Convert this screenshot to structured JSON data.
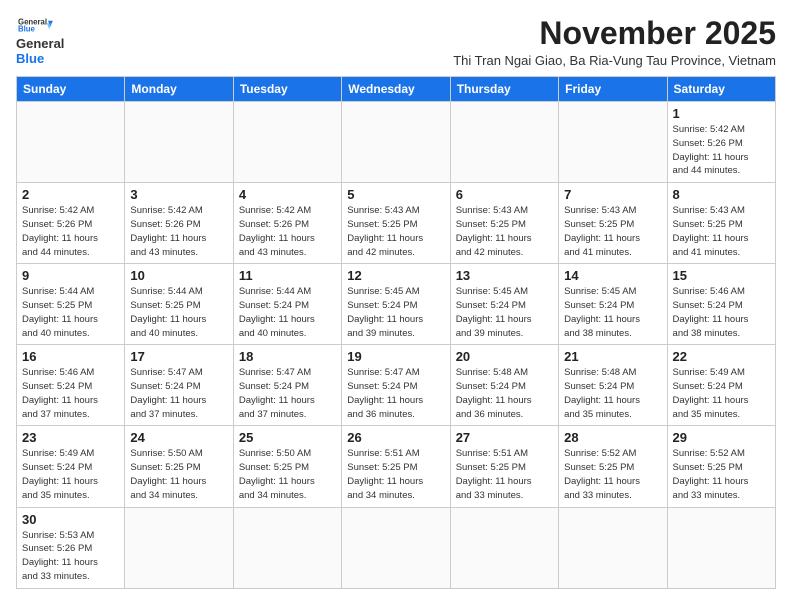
{
  "header": {
    "logo_line1": "General",
    "logo_line2": "Blue",
    "month_title": "November 2025",
    "location": "Thi Tran Ngai Giao, Ba Ria-Vung Tau Province, Vietnam"
  },
  "weekdays": [
    "Sunday",
    "Monday",
    "Tuesday",
    "Wednesday",
    "Thursday",
    "Friday",
    "Saturday"
  ],
  "weeks": [
    [
      {
        "day": "",
        "info": ""
      },
      {
        "day": "",
        "info": ""
      },
      {
        "day": "",
        "info": ""
      },
      {
        "day": "",
        "info": ""
      },
      {
        "day": "",
        "info": ""
      },
      {
        "day": "",
        "info": ""
      },
      {
        "day": "1",
        "info": "Sunrise: 5:42 AM\nSunset: 5:26 PM\nDaylight: 11 hours\nand 44 minutes."
      }
    ],
    [
      {
        "day": "2",
        "info": "Sunrise: 5:42 AM\nSunset: 5:26 PM\nDaylight: 11 hours\nand 44 minutes."
      },
      {
        "day": "3",
        "info": "Sunrise: 5:42 AM\nSunset: 5:26 PM\nDaylight: 11 hours\nand 43 minutes."
      },
      {
        "day": "4",
        "info": "Sunrise: 5:42 AM\nSunset: 5:26 PM\nDaylight: 11 hours\nand 43 minutes."
      },
      {
        "day": "5",
        "info": "Sunrise: 5:43 AM\nSunset: 5:25 PM\nDaylight: 11 hours\nand 42 minutes."
      },
      {
        "day": "6",
        "info": "Sunrise: 5:43 AM\nSunset: 5:25 PM\nDaylight: 11 hours\nand 42 minutes."
      },
      {
        "day": "7",
        "info": "Sunrise: 5:43 AM\nSunset: 5:25 PM\nDaylight: 11 hours\nand 41 minutes."
      },
      {
        "day": "8",
        "info": "Sunrise: 5:43 AM\nSunset: 5:25 PM\nDaylight: 11 hours\nand 41 minutes."
      }
    ],
    [
      {
        "day": "9",
        "info": "Sunrise: 5:44 AM\nSunset: 5:25 PM\nDaylight: 11 hours\nand 40 minutes."
      },
      {
        "day": "10",
        "info": "Sunrise: 5:44 AM\nSunset: 5:25 PM\nDaylight: 11 hours\nand 40 minutes."
      },
      {
        "day": "11",
        "info": "Sunrise: 5:44 AM\nSunset: 5:24 PM\nDaylight: 11 hours\nand 40 minutes."
      },
      {
        "day": "12",
        "info": "Sunrise: 5:45 AM\nSunset: 5:24 PM\nDaylight: 11 hours\nand 39 minutes."
      },
      {
        "day": "13",
        "info": "Sunrise: 5:45 AM\nSunset: 5:24 PM\nDaylight: 11 hours\nand 39 minutes."
      },
      {
        "day": "14",
        "info": "Sunrise: 5:45 AM\nSunset: 5:24 PM\nDaylight: 11 hours\nand 38 minutes."
      },
      {
        "day": "15",
        "info": "Sunrise: 5:46 AM\nSunset: 5:24 PM\nDaylight: 11 hours\nand 38 minutes."
      }
    ],
    [
      {
        "day": "16",
        "info": "Sunrise: 5:46 AM\nSunset: 5:24 PM\nDaylight: 11 hours\nand 37 minutes."
      },
      {
        "day": "17",
        "info": "Sunrise: 5:47 AM\nSunset: 5:24 PM\nDaylight: 11 hours\nand 37 minutes."
      },
      {
        "day": "18",
        "info": "Sunrise: 5:47 AM\nSunset: 5:24 PM\nDaylight: 11 hours\nand 37 minutes."
      },
      {
        "day": "19",
        "info": "Sunrise: 5:47 AM\nSunset: 5:24 PM\nDaylight: 11 hours\nand 36 minutes."
      },
      {
        "day": "20",
        "info": "Sunrise: 5:48 AM\nSunset: 5:24 PM\nDaylight: 11 hours\nand 36 minutes."
      },
      {
        "day": "21",
        "info": "Sunrise: 5:48 AM\nSunset: 5:24 PM\nDaylight: 11 hours\nand 35 minutes."
      },
      {
        "day": "22",
        "info": "Sunrise: 5:49 AM\nSunset: 5:24 PM\nDaylight: 11 hours\nand 35 minutes."
      }
    ],
    [
      {
        "day": "23",
        "info": "Sunrise: 5:49 AM\nSunset: 5:24 PM\nDaylight: 11 hours\nand 35 minutes."
      },
      {
        "day": "24",
        "info": "Sunrise: 5:50 AM\nSunset: 5:25 PM\nDaylight: 11 hours\nand 34 minutes."
      },
      {
        "day": "25",
        "info": "Sunrise: 5:50 AM\nSunset: 5:25 PM\nDaylight: 11 hours\nand 34 minutes."
      },
      {
        "day": "26",
        "info": "Sunrise: 5:51 AM\nSunset: 5:25 PM\nDaylight: 11 hours\nand 34 minutes."
      },
      {
        "day": "27",
        "info": "Sunrise: 5:51 AM\nSunset: 5:25 PM\nDaylight: 11 hours\nand 33 minutes."
      },
      {
        "day": "28",
        "info": "Sunrise: 5:52 AM\nSunset: 5:25 PM\nDaylight: 11 hours\nand 33 minutes."
      },
      {
        "day": "29",
        "info": "Sunrise: 5:52 AM\nSunset: 5:25 PM\nDaylight: 11 hours\nand 33 minutes."
      }
    ],
    [
      {
        "day": "30",
        "info": "Sunrise: 5:53 AM\nSunset: 5:26 PM\nDaylight: 11 hours\nand 33 minutes."
      },
      {
        "day": "",
        "info": ""
      },
      {
        "day": "",
        "info": ""
      },
      {
        "day": "",
        "info": ""
      },
      {
        "day": "",
        "info": ""
      },
      {
        "day": "",
        "info": ""
      },
      {
        "day": "",
        "info": ""
      }
    ]
  ]
}
